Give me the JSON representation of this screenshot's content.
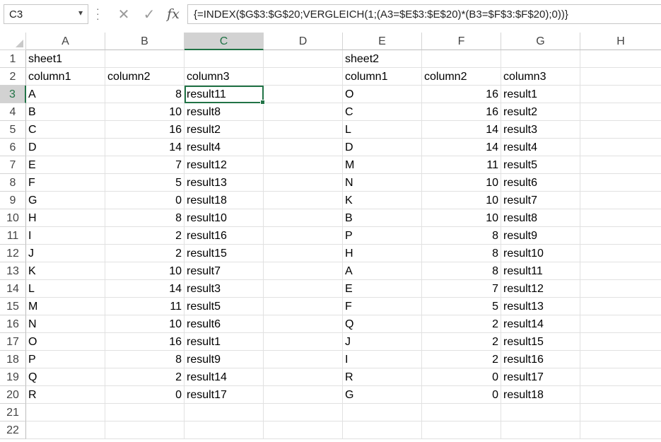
{
  "formula_bar": {
    "name_box": "C3",
    "formula": "{=INDEX($G$3:$G$20;VERGLEICH(1;(A3=$E$3:$E$20)*(B3=$F$3:$F$20);0))}",
    "cancel_icon": "close-icon",
    "enter_icon": "check-icon",
    "fx_label": "fx"
  },
  "sheet": {
    "columns": [
      "A",
      "B",
      "C",
      "D",
      "E",
      "F",
      "G",
      "H"
    ],
    "rows": [
      "1",
      "2",
      "3",
      "4",
      "5",
      "6",
      "7",
      "8",
      "9",
      "10",
      "11",
      "12",
      "13",
      "14",
      "15",
      "16",
      "17",
      "18",
      "19",
      "20",
      "21",
      "22"
    ],
    "selected_column": "C",
    "selected_row": "3",
    "cells": {
      "A": [
        "sheet1",
        "column1",
        "A",
        "B",
        "C",
        "D",
        "E",
        "F",
        "G",
        "H",
        "I",
        "J",
        "K",
        "L",
        "M",
        "N",
        "O",
        "P",
        "Q",
        "R",
        "",
        ""
      ],
      "B": [
        "",
        "column2",
        "8",
        "10",
        "16",
        "14",
        "7",
        "5",
        "0",
        "8",
        "2",
        "2",
        "10",
        "14",
        "11",
        "10",
        "16",
        "8",
        "2",
        "0",
        "",
        ""
      ],
      "C": [
        "",
        "column3",
        "result11",
        "result8",
        "result2",
        "result4",
        "result12",
        "result13",
        "result18",
        "result10",
        "result16",
        "result15",
        "result7",
        "result3",
        "result5",
        "result6",
        "result1",
        "result9",
        "result14",
        "result17",
        "",
        ""
      ],
      "D": [
        "",
        "",
        "",
        "",
        "",
        "",
        "",
        "",
        "",
        "",
        "",
        "",
        "",
        "",
        "",
        "",
        "",
        "",
        "",
        "",
        "",
        ""
      ],
      "E": [
        "sheet2",
        "column1",
        "O",
        "C",
        "L",
        "D",
        "M",
        "N",
        "K",
        "B",
        "P",
        "H",
        "A",
        "E",
        "F",
        "Q",
        "J",
        "I",
        "R",
        "G",
        "",
        ""
      ],
      "F": [
        "",
        "column2",
        "16",
        "16",
        "14",
        "14",
        "11",
        "10",
        "10",
        "10",
        "8",
        "8",
        "8",
        "7",
        "5",
        "2",
        "2",
        "2",
        "0",
        "0",
        "",
        ""
      ],
      "G": [
        "",
        "column3",
        "result1",
        "result2",
        "result3",
        "result4",
        "result5",
        "result6",
        "result7",
        "result8",
        "result9",
        "result10",
        "result11",
        "result12",
        "result13",
        "result14",
        "result15",
        "result16",
        "result17",
        "result18",
        "",
        ""
      ],
      "H": [
        "",
        "",
        "",
        "",
        "",
        "",
        "",
        "",
        "",
        "",
        "",
        "",
        "",
        "",
        "",
        "",
        "",
        "",
        "",
        "",
        "",
        ""
      ]
    }
  },
  "colors": {
    "accent": "#217346",
    "header_selected_bg": "#d2d2d2",
    "gridline": "#e1e1e1"
  }
}
